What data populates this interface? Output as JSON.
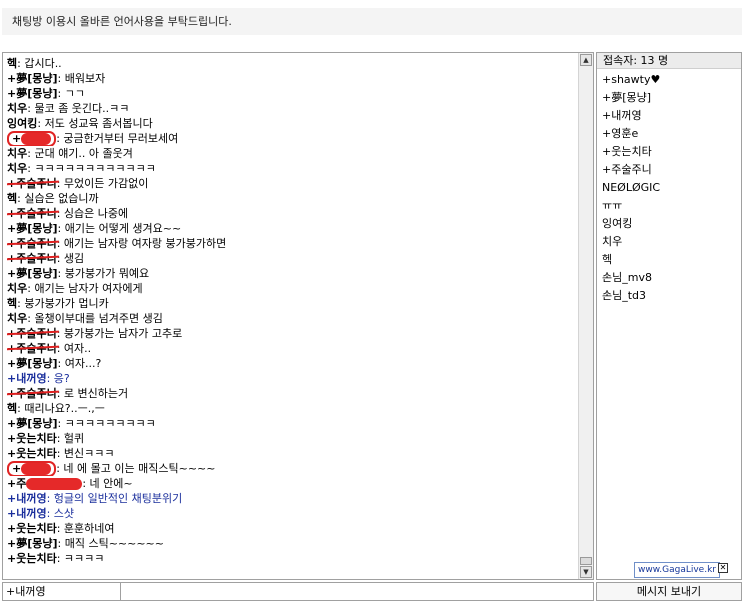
{
  "notice": "채팅방 이용시 올바른 언어사용을 부탁드립니다.",
  "chat": {
    "messages": [
      {
        "nick": "헥",
        "text": "갑시다..",
        "style": "plain"
      },
      {
        "nick": "+夢[몽냥]",
        "text": "배워보자",
        "style": "plain"
      },
      {
        "nick": "+夢[몽냥]",
        "text": "ㄱㄱ",
        "style": "plain"
      },
      {
        "nick": "치우",
        "text": "물코 좀 웃긴다..ㅋㅋ",
        "style": "plain"
      },
      {
        "nick": "잉여킹",
        "text": "저도 성교육 좀서봅니다",
        "style": "plain"
      },
      {
        "nick": "+",
        "text": "궁금한거부터 무러보세여",
        "style": "circled"
      },
      {
        "nick": "치우",
        "text": "군대 얘기.. 아 졸웃겨",
        "style": "plain"
      },
      {
        "nick": "치우",
        "text": "ㅋㅋㅋㅋㅋㅋㅋㅋㅋㅋㅋㅋ",
        "style": "plain"
      },
      {
        "nick": "+주술주니",
        "text": "무었이든 가감없이",
        "style": "strike"
      },
      {
        "nick": "헥",
        "text": "실습은 없습니까",
        "style": "plain"
      },
      {
        "nick": "+주술주니",
        "text": "싱습은 나중에",
        "style": "strike"
      },
      {
        "nick": "+夢[몽냥]",
        "text": "애기는 어떻게 생겨요~~",
        "style": "plain"
      },
      {
        "nick": "+주술주니",
        "text": "애기는 남자랑 여자랑 붕가붕가하면",
        "style": "strike"
      },
      {
        "nick": "+주술주니",
        "text": "생김",
        "style": "strike"
      },
      {
        "nick": "+夢[몽냥]",
        "text": "붕가붕가가 뭐예요",
        "style": "plain"
      },
      {
        "nick": "치우",
        "text": "애기는 남자가 여자에게",
        "style": "plain"
      },
      {
        "nick": "헥",
        "text": "붕가붕가가 멉니카",
        "style": "plain"
      },
      {
        "nick": "치우",
        "text": "올챙이부대를 넘겨주면 생김",
        "style": "plain"
      },
      {
        "nick": "+주술주니",
        "text": "붕가붕가는 남자가 고추로",
        "style": "strike"
      },
      {
        "nick": "+주술주니",
        "text": "여자..",
        "style": "strike"
      },
      {
        "nick": "+夢[몽냥]",
        "text": "여자...?",
        "style": "plain"
      },
      {
        "nick": "+내꺼영",
        "text": "응?",
        "style": "own"
      },
      {
        "nick": "+주술주니",
        "text": "로 변신하는거",
        "style": "strike"
      },
      {
        "nick": "헥",
        "text": "때리나요?..ㅡ.,ㅡ",
        "style": "plain"
      },
      {
        "nick": "+夢[몽냥]",
        "text": "ㅋㅋㅋㅋㅋㅋㅋㅋㅋ",
        "style": "plain"
      },
      {
        "nick": "+웃는치타",
        "text": "헐퀴",
        "style": "plain"
      },
      {
        "nick": "+웃는치타",
        "text": "변신ㅋㅋㅋ",
        "style": "plain"
      },
      {
        "nick": "+",
        "text": "네 에 몰고 이는 매직스틱~~~~",
        "style": "circled"
      },
      {
        "nick": "+주",
        "text": "네 안에~",
        "style": "scribble"
      },
      {
        "nick": "+내꺼영",
        "text": "헝글의 일반적인 채팅분위기",
        "style": "own"
      },
      {
        "nick": "+내꺼영",
        "text": "스샷",
        "style": "own"
      },
      {
        "nick": "+웃는치타",
        "text": "훈훈하네여",
        "style": "plain"
      },
      {
        "nick": "+夢[몽냥]",
        "text": "매직 스틱~~~~~~",
        "style": "plain"
      },
      {
        "nick": "+웃는치타",
        "text": "ㅋㅋㅋㅋ",
        "style": "plain"
      }
    ]
  },
  "users": {
    "count_label": "접속자: 13 명",
    "list": [
      "+shawty♥",
      "+夢[몽냥]",
      "+내꺼영",
      "+영훈e",
      "+웃는치타",
      "+주술주니",
      "NEØLØGIC",
      "ㅠㅠ",
      "잉여킹",
      "치우",
      "헥",
      "손님_mv8",
      "손님_td3"
    ]
  },
  "input": {
    "nickname": "+내꺼영",
    "message_value": "",
    "send_label": "메시지 보내기"
  },
  "branding": {
    "text": "www.GagaLive.kr",
    "close_glyph": "✕"
  },
  "scroll": {
    "up_glyph": "▲",
    "down_glyph": "▼"
  },
  "colors": {
    "own_text": "#1a2e9c",
    "redaction": "#e02424"
  }
}
